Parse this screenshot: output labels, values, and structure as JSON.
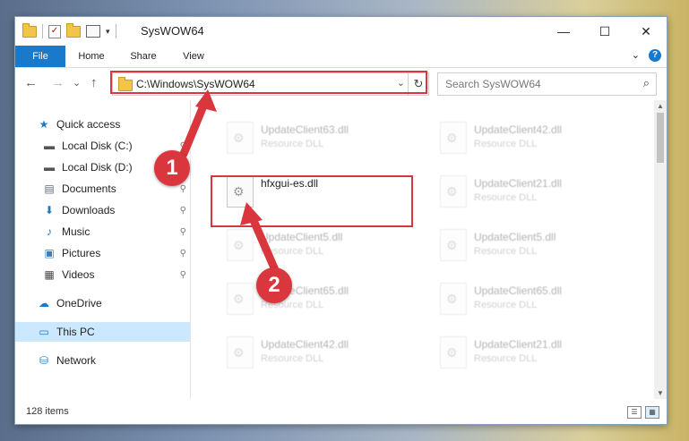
{
  "window": {
    "title": "SysWOW64",
    "minimize_label": "—",
    "maximize_label": "☐",
    "close_label": "✕"
  },
  "ribbon": {
    "tabs": [
      "File",
      "Home",
      "Share",
      "View"
    ],
    "expand_label": "⌄",
    "help_label": "?"
  },
  "nav": {
    "back_label": "←",
    "forward_label": "→",
    "recent_label": "⌄",
    "up_label": "↑",
    "address": "C:\\Windows\\SysWOW64",
    "address_dropdown": "⌄",
    "refresh_label": "↻",
    "search_placeholder": "Search SysWOW64",
    "search_icon": "⌕"
  },
  "sidebar": {
    "items": [
      {
        "label": "Quick access",
        "icon": "star-icon",
        "glyph": "★",
        "color": "#1979ca",
        "pinned": false
      },
      {
        "label": "Local Disk (C:)",
        "icon": "drive-icon",
        "glyph": "▬",
        "color": "#555555",
        "pinned": true
      },
      {
        "label": "Local Disk (D:)",
        "icon": "drive-icon",
        "glyph": "▬",
        "color": "#555555",
        "pinned": true
      },
      {
        "label": "Documents",
        "icon": "documents-icon",
        "glyph": "▤",
        "color": "#5b6b7c",
        "pinned": true
      },
      {
        "label": "Downloads",
        "icon": "download-icon",
        "glyph": "⬇",
        "color": "#1979ca",
        "pinned": true
      },
      {
        "label": "Music",
        "icon": "music-icon",
        "glyph": "♪",
        "color": "#1979ca",
        "pinned": true
      },
      {
        "label": "Pictures",
        "icon": "pictures-icon",
        "glyph": "▣",
        "color": "#3a7cc0",
        "pinned": true
      },
      {
        "label": "Videos",
        "icon": "videos-icon",
        "glyph": "▦",
        "color": "#444444",
        "pinned": true
      },
      {
        "label": "OneDrive",
        "icon": "cloud-icon",
        "glyph": "☁",
        "color": "#1979ca",
        "pinned": false
      },
      {
        "label": "This PC",
        "icon": "computer-icon",
        "glyph": "▭",
        "color": "#1979ca",
        "pinned": false
      },
      {
        "label": "Network",
        "icon": "network-icon",
        "glyph": "⛁",
        "color": "#1979ca",
        "pinned": false
      }
    ],
    "pin_glyph": "📌"
  },
  "files": [
    {
      "name": "UpdateClient63.dll",
      "type": "Resource DLL"
    },
    {
      "name": "UpdateClient42.dll",
      "type": "Resource DLL"
    },
    {
      "name": "hfxgui-es.dll",
      "type": ""
    },
    {
      "name": "UpdateClient21.dll",
      "type": "Resource DLL"
    },
    {
      "name": "UpdateClient5.dll",
      "type": "Resource DLL"
    },
    {
      "name": "UpdateClient5.dll",
      "type": "Resource DLL"
    },
    {
      "name": "UpdateClient65.dll",
      "type": "Resource DLL"
    },
    {
      "name": "UpdateClient65.dll",
      "type": "Resource DLL"
    },
    {
      "name": "UpdateClient42.dll",
      "type": "Resource DLL"
    },
    {
      "name": "UpdateClient21.dll",
      "type": "Resource DLL"
    }
  ],
  "status": {
    "item_count": "128 items"
  },
  "annotations": {
    "step1": "1",
    "step2": "2",
    "color": "#d9363e"
  }
}
